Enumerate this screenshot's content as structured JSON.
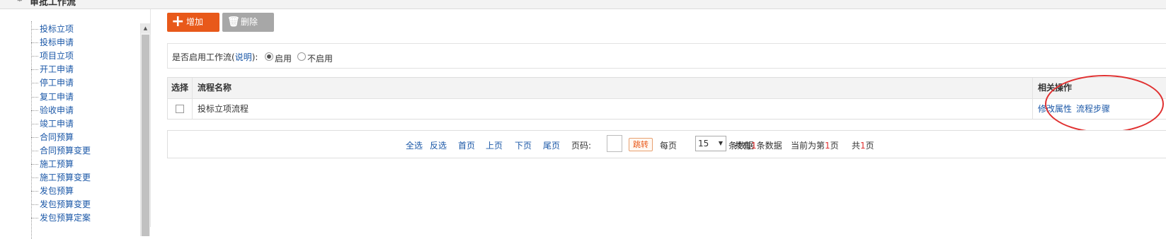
{
  "panel": {
    "title": "审批工作流",
    "icon": "gear-icon"
  },
  "tree": {
    "items": [
      "投标立项",
      "投标申请",
      "项目立项",
      "开工申请",
      "停工申请",
      "复工申请",
      "验收申请",
      "竣工申请",
      "合同预算",
      "合同预算变更",
      "施工预算",
      "施工预算变更",
      "发包预算",
      "发包预算变更",
      "发包预算定案"
    ]
  },
  "toolbar": {
    "add_label": "增加",
    "delete_label": "删除"
  },
  "workflow_switch": {
    "label": "是否启用工作流",
    "help_open": "(",
    "help_link": "说明",
    "help_close": "):",
    "option_on": "启用",
    "option_off": "不启用",
    "selected": "启用"
  },
  "table": {
    "columns": {
      "select": "选择",
      "name": "流程名称",
      "ops": "相关操作"
    },
    "rows": [
      {
        "name": "投标立项流程",
        "op1": "修改属性",
        "op2": "流程步骤"
      }
    ]
  },
  "pager": {
    "select_all": "全选",
    "invert": "反选",
    "first": "首页",
    "prev": "上页",
    "next": "下页",
    "last": "尾页",
    "page_label": "页码:",
    "go": "跳转",
    "per_page_label": "每页",
    "per_page_value": "15",
    "per_page_suffix": "条数据",
    "total_prefix": "共有",
    "total_count": "1",
    "total_suffix": "条数据",
    "current_prefix": "当前为第",
    "current_page": "1",
    "current_suffix": "页",
    "pages_prefix": "共",
    "pages_count": "1",
    "pages_suffix": "页"
  },
  "colors": {
    "accent": "#e8591a",
    "link": "#1a57a7",
    "highlight_circle": "#e03030"
  }
}
